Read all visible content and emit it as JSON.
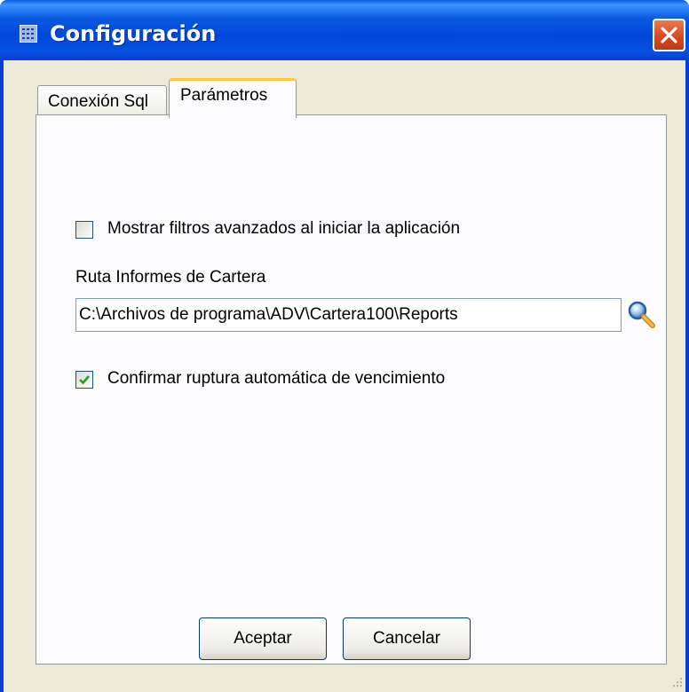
{
  "window": {
    "title": "Configuración",
    "app_icon": "grid-app-icon",
    "close_icon": "close-icon"
  },
  "tabs": [
    {
      "label": "Conexión Sql",
      "active": false
    },
    {
      "label": "Parámetros",
      "active": true
    }
  ],
  "parametros": {
    "show_filters": {
      "label": "Mostrar filtros avanzados al iniciar la aplicación",
      "checked": false
    },
    "report_path": {
      "label": "Ruta Informes de Cartera",
      "value": "C:\\Archivos de programa\\ADV\\Cartera100\\Reports",
      "browse_icon": "magnifier-icon"
    },
    "confirm_break": {
      "label": "Confirmar ruptura automática de vencimiento",
      "checked": true
    }
  },
  "buttons": {
    "accept": "Aceptar",
    "cancel": "Cancelar"
  },
  "colors": {
    "titlebar": "#0a5ae0",
    "close": "#d94a22",
    "active_tab_accent": "#ffc83c",
    "check": "#21a121"
  }
}
